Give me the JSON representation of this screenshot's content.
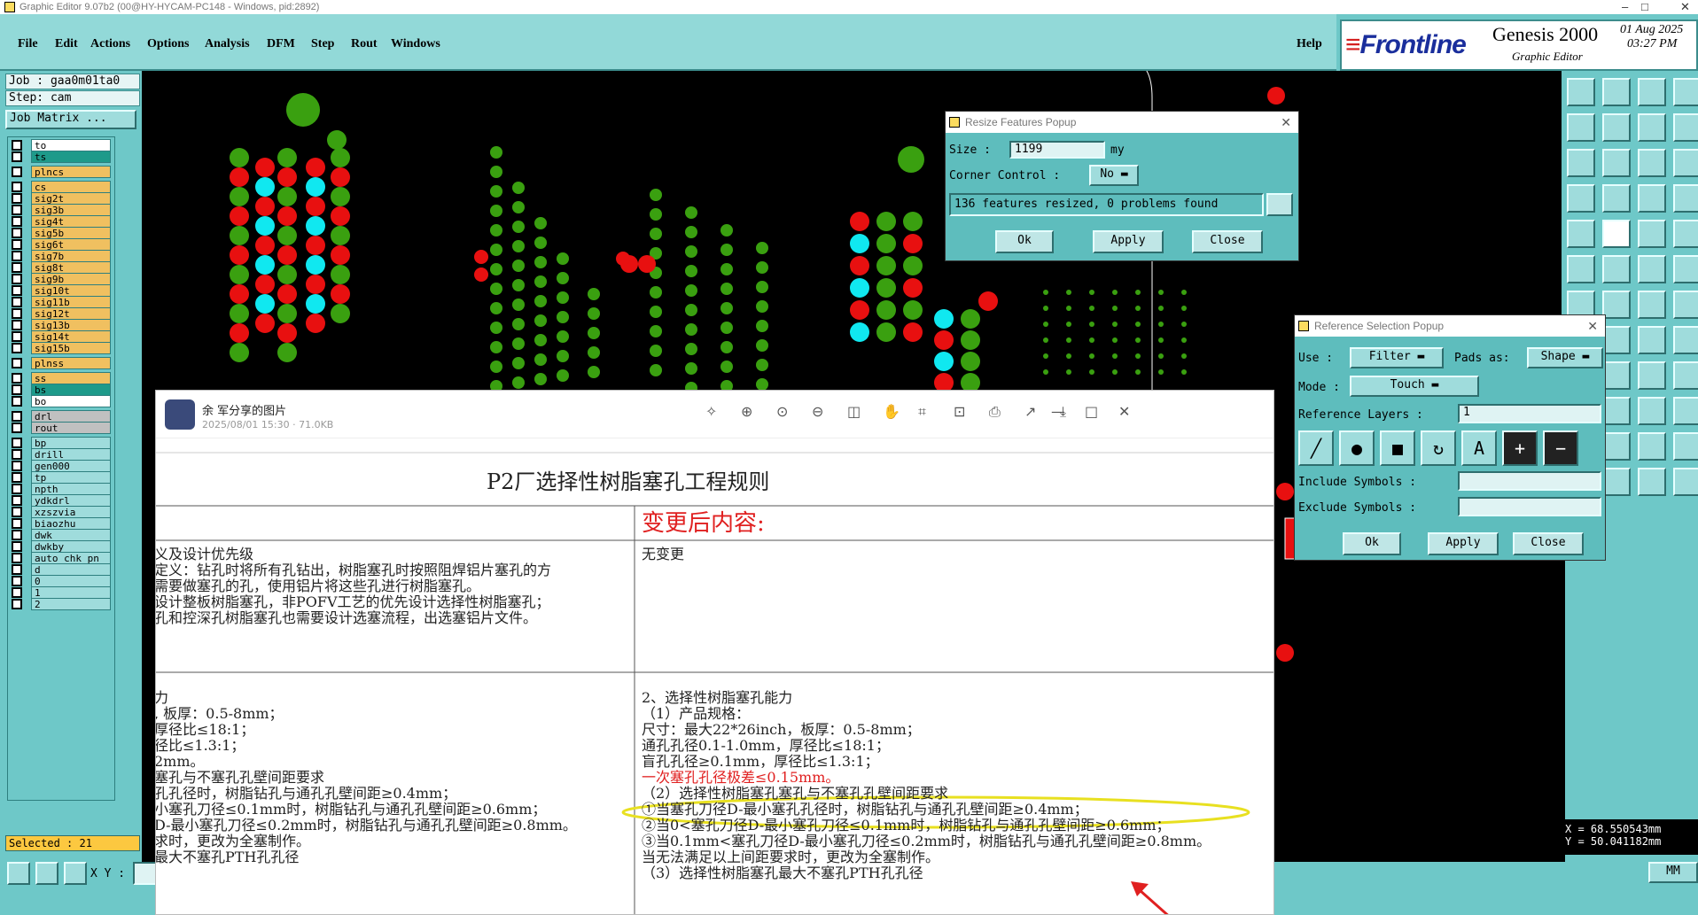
{
  "titlebar": {
    "title": "Graphic Editor 9.07b2 (00@HY-HYCAM-PC148 - Windows, pid:2892)",
    "minimize": "–",
    "maximize": "□",
    "close": "✕"
  },
  "menu": [
    "File",
    "Edit",
    "Actions",
    "Options",
    "Analysis",
    "DFM",
    "Step",
    "Rout",
    "Windows"
  ],
  "help": "Help",
  "logo": {
    "brand": "Frontline",
    "product": "Genesis 2000",
    "subtitle": "Graphic Editor",
    "date": "01 Aug 2025",
    "time": "03:27 PM"
  },
  "job": {
    "job_label": "Job : gaa0m01ta0",
    "step_label": "Step: cam",
    "matrix_button": "Job Matrix ..."
  },
  "layers": [
    {
      "name": "to",
      "color": "#ffffff"
    },
    {
      "name": "ts",
      "color": "#1e9a8a"
    },
    {
      "name": "plncs",
      "color": "#f0c060"
    },
    {
      "name": "cs",
      "color": "#f0c060"
    },
    {
      "name": "sig2t",
      "color": "#f0c060"
    },
    {
      "name": "sig3b",
      "color": "#f0c060"
    },
    {
      "name": "sig4t",
      "color": "#f0c060"
    },
    {
      "name": "sig5b",
      "color": "#f0c060"
    },
    {
      "name": "sig6t",
      "color": "#f0c060"
    },
    {
      "name": "sig7b",
      "color": "#f0c060"
    },
    {
      "name": "sig8t",
      "color": "#f0c060"
    },
    {
      "name": "sig9b",
      "color": "#f0c060"
    },
    {
      "name": "sig10t",
      "color": "#f0c060"
    },
    {
      "name": "sig11b",
      "color": "#f0c060"
    },
    {
      "name": "sig12t",
      "color": "#f0c060"
    },
    {
      "name": "sig13b",
      "color": "#f0c060"
    },
    {
      "name": "sig14t",
      "color": "#f0c060"
    },
    {
      "name": "sig15b",
      "color": "#f0c060"
    },
    {
      "name": "plnss",
      "color": "#f0c060"
    },
    {
      "name": "ss",
      "color": "#f0c060"
    },
    {
      "name": "bs",
      "color": "#1e9a8a"
    },
    {
      "name": "bo",
      "color": "#ffffff"
    },
    {
      "name": "drl",
      "color": "#c0c0c0"
    },
    {
      "name": "rout",
      "color": "#c0c0c0"
    },
    {
      "name": "bp",
      "color": "#9fdcdc"
    },
    {
      "name": "drill",
      "color": "#9fdcdc"
    },
    {
      "name": "gen000",
      "color": "#9fdcdc"
    },
    {
      "name": "tp",
      "color": "#9fdcdc"
    },
    {
      "name": "npth",
      "color": "#9fdcdc"
    },
    {
      "name": "ydkdrl",
      "color": "#9fdcdc"
    },
    {
      "name": "xzszvia",
      "color": "#9fdcdc"
    },
    {
      "name": "biaozhu",
      "color": "#9fdcdc"
    },
    {
      "name": "dwk",
      "color": "#9fdcdc"
    },
    {
      "name": "dwkby",
      "color": "#9fdcdc"
    },
    {
      "name": "auto_chk_pn",
      "color": "#9fdcdc"
    },
    {
      "name": "d",
      "color": "#9fdcdc"
    },
    {
      "name": "0",
      "color": "#9fdcdc"
    },
    {
      "name": "1",
      "color": "#9fdcdc"
    },
    {
      "name": "2",
      "color": "#9fdcdc"
    }
  ],
  "selected": "Selected : 21",
  "xy_label": "X Y :",
  "units": "MM",
  "coords": {
    "x": "X = 68.550543mm",
    "y": "Y = 50.041182mm"
  },
  "resize_popup": {
    "title": "Resize Features Popup",
    "size_label": "Size :",
    "size_value": "1199",
    "size_unit": "my",
    "corner_label": "Corner Control :",
    "corner_value": "No",
    "status": "136 features resized, 0 problems found",
    "ok": "Ok",
    "apply": "Apply",
    "close": "Close"
  },
  "ref_popup": {
    "title": "Reference Selection Popup",
    "use_label": "Use :",
    "use_value": "Filter",
    "pads_label": "Pads as:",
    "pads_value": "Shape",
    "mode_label": "Mode :",
    "mode_value": "Touch",
    "ref_layers_label": "Reference Layers :",
    "ref_layers_value": "1",
    "include_label": "Include Symbols :",
    "exclude_label": "Exclude Symbols :",
    "ok": "Ok",
    "apply": "Apply",
    "close": "Close"
  },
  "photo": {
    "sender": "余 军分享的图片",
    "meta": "2025/08/01 15:30 · 71.0KB"
  },
  "doc": {
    "title": "P2厂选择性树脂塞孔工程规则",
    "changed_header": "变更后内容:",
    "left_col": [
      "义及设计优先级",
      "定义：钻孔时将所有孔钻出，树脂塞孔时按照阻焊铝片塞孔的方",
      "需要做塞孔的孔，使用铝片将这些孔进行树脂塞孔。",
      "设计整板树脂塞孔，非POFV工艺的优先设计选择性树脂塞孔；",
      "孔和控深孔树脂塞孔也需要设计选塞流程，出选塞铝片文件。",
      "力",
      ", 板厚：0.5-8mm；",
      "厚径比≤18:1；",
      "径比≤1.3:1；",
      "2mm。",
      "塞孔与不塞孔孔壁间距要求",
      "孔孔径时，树脂钻孔与通孔孔壁间距≥0.4mm；",
      "小塞孔刀径≤0.1mm时，树脂钻孔与通孔孔壁间距≥0.6mm；",
      "D-最小塞孔刀径≤0.2mm时，树脂钻孔与通孔孔壁间距≥0.8mm。",
      "求时，更改为全塞制作。",
      "最大不塞孔PTH孔孔径"
    ],
    "right_col": [
      "无变更",
      "2、选择性树脂塞孔能力",
      "（1）产品规格：",
      "尺寸：最大22*26inch，板厚：0.5-8mm；",
      "通孔孔径0.1-1.0mm，厚径比≤18:1；",
      "盲孔孔径≥0.1mm，厚径比≤1.3:1；",
      "一次塞孔孔径极差≤0.15mm。",
      "（2）选择性树脂塞孔塞孔与不塞孔孔壁间距要求",
      "①当塞孔刀径D-最小塞孔孔径时，树脂钻孔与通孔孔壁间距≥0.4mm；",
      "②当0<塞孔刀径D-最小塞孔刀径≤0.1mm时，树脂钻孔与通孔孔壁间距≥0.6mm；",
      "③当0.1mm<塞孔刀径D-最小塞孔刀径≤0.2mm时，树脂钻孔与通孔孔壁间距≥0.8mm。",
      "当无法满足以上间距要求时，更改为全塞制作。",
      "（3）选择性树脂塞孔最大不塞孔PTH孔孔径"
    ]
  }
}
